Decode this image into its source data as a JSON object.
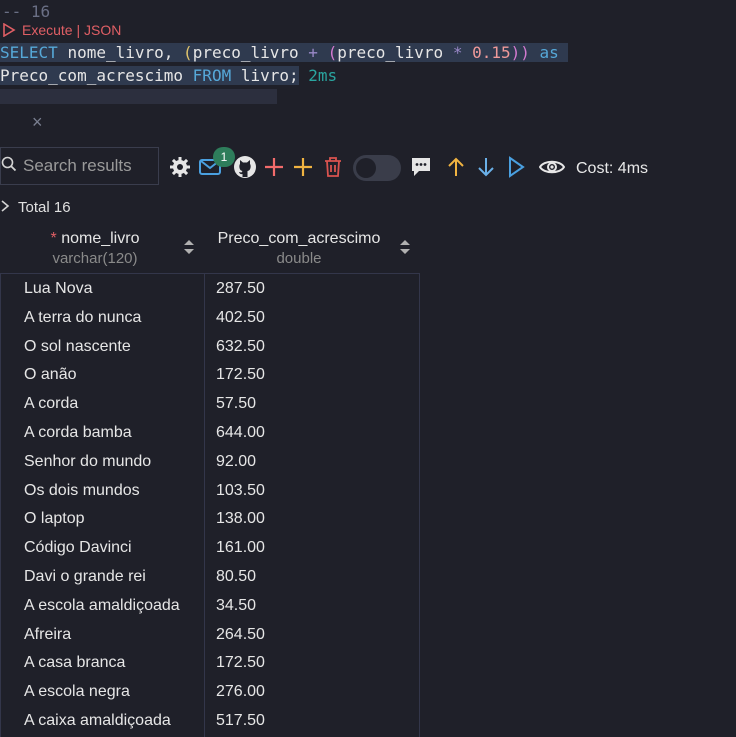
{
  "editor": {
    "comment": "-- 16",
    "codelens": "Execute | JSON",
    "query_line1": {
      "select": "SELECT",
      "col1": "nome_livro,",
      "open1": "(",
      "col2": "preco_livro",
      "plus": "+",
      "open2": "(",
      "col3": "preco_livro",
      "star": "*",
      "num": "0.15",
      "close": "))",
      "as": "as"
    },
    "query_line2": {
      "alias": "Preco_com_acrescimo",
      "from": "FROM",
      "table": "livro;",
      "duration": "2ms"
    }
  },
  "toolbar": {
    "search_placeholder": "Search results",
    "badge_count": "1",
    "cost": "Cost: 4ms",
    "colors": {
      "plus": "#f26b6b",
      "plus_alt": "#f0b341",
      "arrow_up": "#f0b341",
      "arrow_down": "#6ab0e8",
      "play": "#4aa0e0"
    }
  },
  "results": {
    "total": "Total 16",
    "columns": [
      {
        "name": "nome_livro",
        "type": "varchar(120)",
        "required_marker": "*"
      },
      {
        "name": "Preco_com_acrescimo",
        "type": "double"
      }
    ],
    "rows": [
      [
        "Lua Nova",
        "287.50"
      ],
      [
        "A terra do nunca",
        "402.50"
      ],
      [
        "O sol nascente",
        "632.50"
      ],
      [
        "O anão",
        "172.50"
      ],
      [
        "A corda",
        "57.50"
      ],
      [
        "A corda bamba",
        "644.00"
      ],
      [
        "Senhor do mundo",
        "92.00"
      ],
      [
        "Os dois mundos",
        "103.50"
      ],
      [
        "O laptop",
        "138.00"
      ],
      [
        "Código Davinci",
        "161.00"
      ],
      [
        "Davi o grande rei",
        "80.50"
      ],
      [
        "A escola amaldiçoada",
        "34.50"
      ],
      [
        "Afreira",
        "264.50"
      ],
      [
        "A casa branca",
        "172.50"
      ],
      [
        "A escola negra",
        "276.00"
      ],
      [
        "A caixa amaldiçoada",
        "517.50"
      ]
    ]
  }
}
